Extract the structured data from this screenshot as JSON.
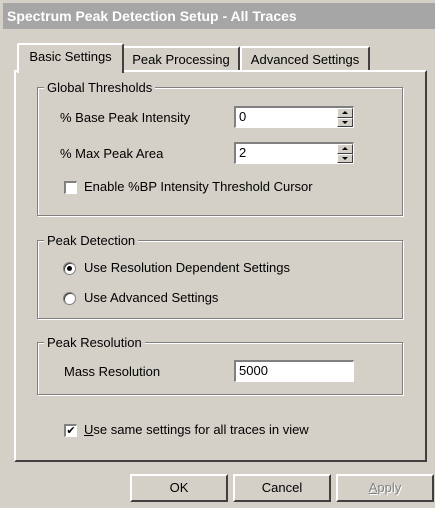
{
  "window": {
    "title": "Spectrum Peak Detection Setup - All Traces"
  },
  "tabs": [
    {
      "label": "Basic Settings",
      "active": true
    },
    {
      "label": "Peak Processing",
      "active": false
    },
    {
      "label": "Advanced Settings",
      "active": false
    }
  ],
  "global_thresholds": {
    "title": "Global Thresholds",
    "base_peak_label": "% Base Peak Intensity",
    "base_peak_value": "0",
    "max_peak_area_label": "% Max Peak Area",
    "max_peak_area_value": "2",
    "cursor_checkbox_label": "Enable %BP Intensity Threshold Cursor",
    "cursor_checked": false
  },
  "peak_detection": {
    "title": "Peak Detection",
    "option_resolution_label": "Use Resolution Dependent Settings",
    "option_advanced_label": "Use Advanced Settings",
    "selected": "resolution"
  },
  "peak_resolution": {
    "title": "Peak Resolution",
    "mass_resolution_label": "Mass Resolution",
    "mass_resolution_value": "5000"
  },
  "same_settings": {
    "label_first": "U",
    "label_rest": "se same settings for all traces in view",
    "checked": true,
    "check_mark": "✔"
  },
  "buttons": {
    "ok": "OK",
    "cancel": "Cancel",
    "apply_first": "A",
    "apply_rest": "pply"
  }
}
